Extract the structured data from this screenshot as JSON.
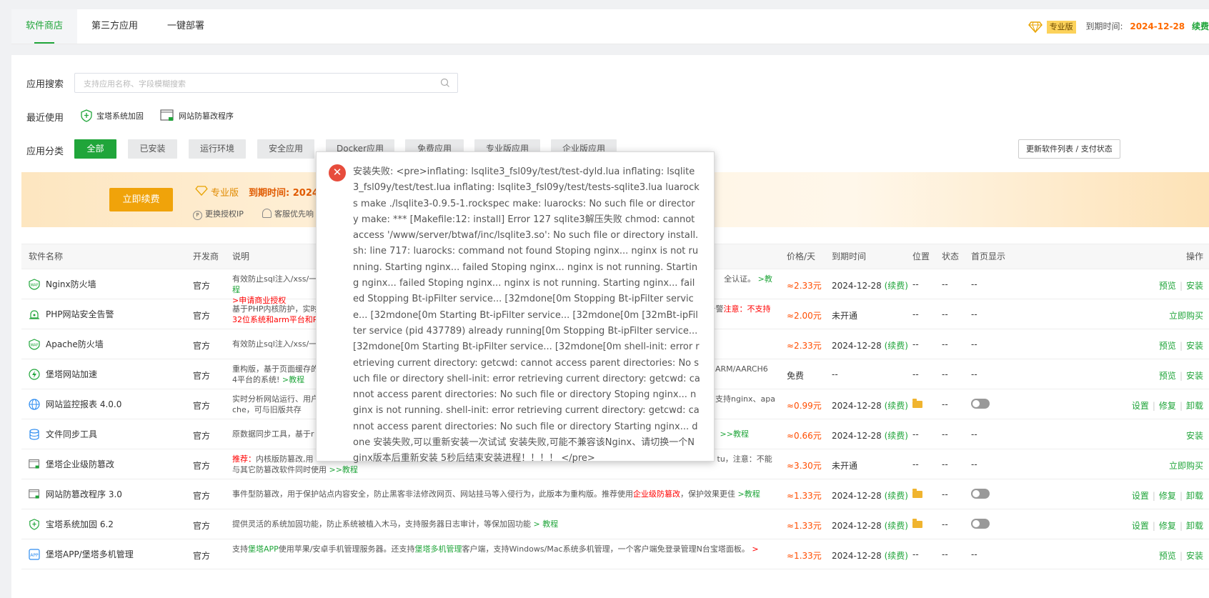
{
  "tabs": [
    {
      "label": "软件商店",
      "active": true
    },
    {
      "label": "第三方应用",
      "active": false
    },
    {
      "label": "一键部署",
      "active": false
    }
  ],
  "pro_info": {
    "badge": "专业版",
    "expire_label": "到期时间:",
    "expire_date": "2024-12-28",
    "renew_link": "续费"
  },
  "search": {
    "label": "应用搜索",
    "placeholder": "支持应用名称、字段模糊搜索"
  },
  "recent": {
    "label": "最近使用",
    "items": [
      "宝塔系统加固",
      "网站防篡改程序"
    ]
  },
  "categories": {
    "label": "应用分类",
    "items": [
      "全部",
      "已安装",
      "运行环境",
      "安全应用",
      "Docker应用",
      "免费应用",
      "专业版应用",
      "企业版应用"
    ],
    "active_index": 0
  },
  "update_button": "更新软件列表 / 支付状态",
  "banner": {
    "renew_button": "立即续费",
    "pro_label": "专业版",
    "expire_text": "到期时间: 2024-",
    "sub_items": [
      "更换授权IP",
      "客服优先响"
    ]
  },
  "table": {
    "headers": [
      "软件名称",
      "开发商",
      "说明",
      "价格/天",
      "到期时间",
      "位置",
      "状态",
      "首页显示",
      "操作"
    ],
    "rows": [
      {
        "name": "Nginx防火墙",
        "dev": "官方",
        "desc_main": "有效防止sql注入/xss/一",
        "desc_tail": "全认证。",
        "desc_link": ">教程",
        "desc_line2": ">申请商业授权",
        "price": "≈2.33元",
        "expire": "2024-12-28",
        "renew": "(续费)",
        "pos": "--",
        "state": "--",
        "home": "--",
        "op1": "预览",
        "op2": "安装",
        "icon_color": "#20a53a"
      },
      {
        "name": "PHP网站安全告警",
        "dev": "官方",
        "desc_main": "基于PHP内核防护，实时",
        "desc_tail": "告警",
        "desc_warn": "注意：不支持",
        "desc_line2": "32位系统和arm平台和P",
        "price": "≈2.00元",
        "expire": "未开通",
        "pos": "--",
        "state": "--",
        "home": "--",
        "op1": "立即购买",
        "icon_color": "#20a53a"
      },
      {
        "name": "Apache防火墙",
        "dev": "官方",
        "desc_main": "有效防止sql注入/xss/一",
        "price": "≈2.33元",
        "expire": "2024-12-28",
        "renew": "(续费)",
        "pos": "--",
        "state": "--",
        "home": "--",
        "op1": "预览",
        "op2": "安装",
        "icon_color": "#20a53a"
      },
      {
        "name": "堡塔网站加速",
        "dev": "官方",
        "desc_main": "重构版，基于页面缓存的",
        "desc_tail": "ARM/AARCH6",
        "desc_line2": "4平台的系统!",
        "desc_link": ">教程",
        "price": "免费",
        "expire": "--",
        "pos": "--",
        "state": "--",
        "home": "--",
        "op1": "预览",
        "op2": "安装",
        "icon_color": "#20a53a"
      },
      {
        "name": "网站监控报表 4.0.0",
        "dev": "官方",
        "desc_main": "实时分析网站运行、用户",
        "desc_tail": "支持nginx、apa",
        "desc_line2": "che，可与旧版共存",
        "price": "≈0.99元",
        "expire": "2024-12-28",
        "renew": "(续费)",
        "state": "--",
        "op1": "设置",
        "op2": "修复",
        "op3": "卸载",
        "icon_color": "#2d8cf0"
      },
      {
        "name": "文件同步工具",
        "dev": "官方",
        "desc_main": "原数据同步工具，基于r",
        "desc_link": ">>教程",
        "price": "≈0.66元",
        "expire": "2024-12-28",
        "renew": "(续费)",
        "pos": "--",
        "state": "--",
        "home": "--",
        "op1": "安装",
        "icon_color": "#2d8cf0"
      },
      {
        "name": "堡塔企业级防篡改",
        "dev": "官方",
        "desc_warn": "推荐：",
        "desc_main": "内核版防篡改,用",
        "desc_tail": "tu，注意：不能",
        "desc_line2": "与其它防篡改软件同时使用",
        "desc_link": ">>教程",
        "price": "≈3.30元",
        "expire": "未开通",
        "pos": "--",
        "state": "--",
        "home": "--",
        "op1": "立即购买",
        "icon_color": "#666"
      },
      {
        "name": "网站防篡改程序 3.0",
        "dev": "官方",
        "desc_main": "事件型防篡改，用于保护站点内容安全，防止黑客非法修改网页、网站挂马等入侵行为，此版本为重构版。推荐使用",
        "desc_warn": "企业级防篡改",
        "desc_tail": "，保护效果更佳",
        "desc_link": ">教程",
        "price": "≈1.33元",
        "expire": "2024-12-28",
        "renew": "(续费)",
        "state": "--",
        "op1": "设置",
        "op2": "修复",
        "op3": "卸载",
        "icon_color": "#666"
      },
      {
        "name": "宝塔系统加固 6.2",
        "dev": "官方",
        "desc_main": "提供灵活的系统加固功能，防止系统被植入木马，支持服务器日志审计，等保加固功能",
        "desc_link": "> 教程",
        "price": "≈1.33元",
        "expire": "2024-12-28",
        "renew": "(续费)",
        "state": "--",
        "op1": "设置",
        "op2": "修复",
        "op3": "卸载",
        "icon_color": "#20a53a"
      },
      {
        "name": "堡塔APP/堡塔多机管理",
        "dev": "官方",
        "desc_pre": "支持",
        "desc_hl1": "堡塔APP",
        "desc_mid": "使用苹果/安卓手机管理服务器。还支持",
        "desc_hl2": "堡塔多机管理",
        "desc_main": "客户端，支持Windows/Mac系统多机管理，一个客户端免登录管理N台宝塔面板。",
        "desc_link": ">",
        "price": "≈1.33元",
        "expire": "2024-12-28",
        "renew": "(续费)",
        "pos": "--",
        "state": "--",
        "home": "--",
        "op1": "预览",
        "op2": "安装",
        "icon_color": "#2d8cf0"
      }
    ]
  },
  "dialog": {
    "message": "安装失败: <pre>inflating: lsqlite3_fsl09y/test/test-dyld.lua inflating: lsqlite3_fsl09y/test/test.lua inflating: lsqlite3_fsl09y/test/tests-sqlite3.lua luarocks make ./lsqlite3-0.9.5-1.rockspec make: luarocks: No such file or directory make: *** [Makefile:12: install] Error 127 sqlite3解压失败 chmod: cannot access '/www/server/btwaf/inc/lsqlite3.so': No such file or directory install.sh: line 717: luarocks: command not found Stoping nginx... nginx is not running. Starting nginx... failed Stoping nginx... nginx is not running. Starting nginx... failed Stoping nginx... nginx is not running. Starting nginx... failed Stopping Bt-ipFilter service... [32mdone[0m Stopping Bt-ipFilter service... [32mdone[0m Starting Bt-ipFilter service... [32mdone[0m [32mBt-ipFilter service (pid 437789) already running[0m Stopping Bt-ipFilter service... [32mdone[0m Starting Bt-ipFilter service... [32mdone[0m shell-init: error retrieving current directory: getcwd: cannot access parent directories: No such file or directory shell-init: error retrieving current directory: getcwd: cannot access parent directories: No such file or directory Stoping nginx... nginx is not running. shell-init: error retrieving current directory: getcwd: cannot access parent directories: No such file or directory Starting nginx... done 安装失败,可以重新安装一次试试 安装失败,可能不兼容该Nginx、请切换一个Nginx版本后重新安装 5秒后结束安装进程！！！！ </pre>",
    "icon": "close-icon"
  },
  "colors": {
    "accent": "#20a53a",
    "error": "#e74c3c",
    "price": "#ff4d00",
    "warn": "#ff0000"
  }
}
